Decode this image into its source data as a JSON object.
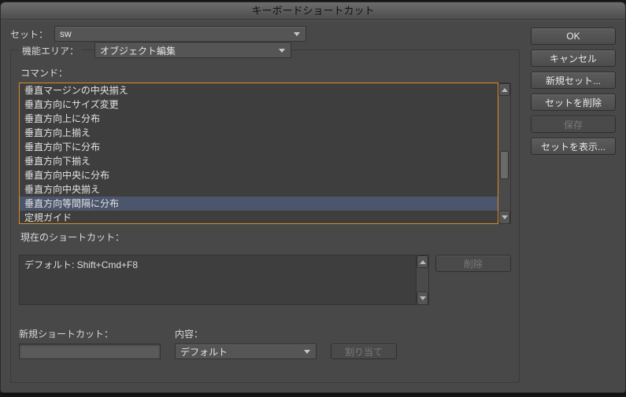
{
  "window": {
    "title": "キーボードショートカット"
  },
  "setRow": {
    "label": "セット：",
    "value": "sw"
  },
  "areaRow": {
    "label": "機能エリア：",
    "value": "オブジェクト編集"
  },
  "commands": {
    "label": "コマンド：",
    "items": [
      "垂直マージンの中央揃え",
      "垂直方向にサイズ変更",
      "垂直方向上に分布",
      "垂直方向上揃え",
      "垂直方向下に分布",
      "垂直方向下揃え",
      "垂直方向中央に分布",
      "垂直方向中央揃え",
      "垂直方向等間隔に分布",
      "定規ガイド"
    ],
    "selected_index": 8
  },
  "current": {
    "label": "現在のショートカット：",
    "value": "デフォルト: Shift+Cmd+F8",
    "delete_label": "削除"
  },
  "newShortcut": {
    "label": "新規ショートカット：",
    "context_label": "内容：",
    "context_value": "デフォルト",
    "assign_label": "割り当て"
  },
  "side": {
    "ok": "OK",
    "cancel": "キャンセル",
    "new_set": "新規セット...",
    "delete_set": "セットを削除",
    "save": "保存",
    "show_set": "セットを表示..."
  }
}
